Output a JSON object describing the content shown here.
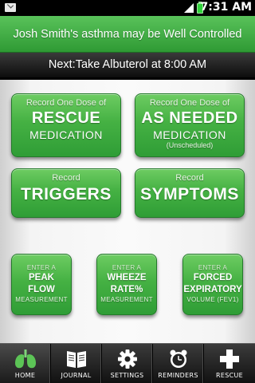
{
  "status_bar": {
    "time": "7:31 AM",
    "icons": [
      "mail-icon",
      "signal-icon",
      "battery-icon"
    ]
  },
  "banner": {
    "status_text": "Josh Smith's asthma may be Well Controlled",
    "next_text": "Next:Take Albuterol at 8:00 AM"
  },
  "colors": {
    "button_green": "#45b143",
    "banner_green": "#3fab42",
    "tabbar_dark": "#1a1a1a"
  },
  "buttons": {
    "rescue": {
      "line1": "Record One Dose of",
      "line2": "RESCUE",
      "line3": "MEDICATION"
    },
    "as_needed": {
      "line1": "Record One Dose of",
      "line2": "AS NEEDED",
      "line3": "MEDICATION",
      "line4": "(Unscheduled)"
    },
    "triggers": {
      "line1": "Record",
      "line2": "TRIGGERS"
    },
    "symptoms": {
      "line1": "Record",
      "line2": "SYMPTOMS"
    },
    "peak_flow": {
      "top": "ENTER A",
      "main1": "PEAK",
      "main2": "FLOW",
      "bottom": "MEASUREMENT"
    },
    "wheeze": {
      "top": "ENTER A",
      "main1": "WHEEZE",
      "main2": "RATE%",
      "bottom": "MEASUREMENT"
    },
    "fev1": {
      "top": "ENTER A",
      "main1": "FORCED",
      "main2": "EXPIRATORY",
      "bottom": "VOLUME (FEV1)"
    }
  },
  "tabs": [
    {
      "label": "HOME",
      "icon": "lungs-icon",
      "active": true
    },
    {
      "label": "JOURNAL",
      "icon": "journal-icon",
      "active": false
    },
    {
      "label": "SETTINGS",
      "icon": "gear-icon",
      "active": false
    },
    {
      "label": "REMINDERS",
      "icon": "alarm-clock-icon",
      "active": false
    },
    {
      "label": "RESCUE",
      "icon": "plus-icon",
      "active": false
    }
  ]
}
